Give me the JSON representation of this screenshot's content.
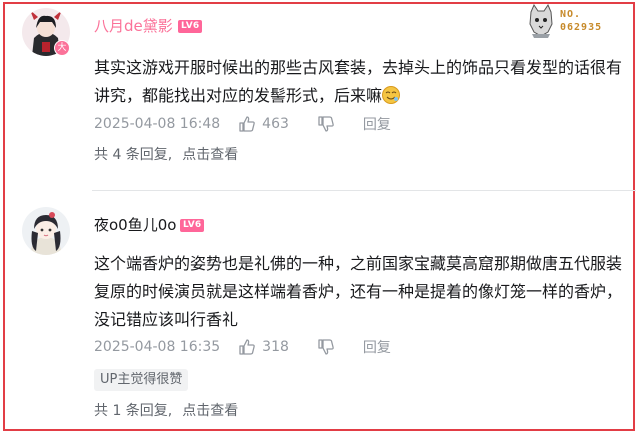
{
  "watermark": {
    "line1": "NO.",
    "line2": "062935"
  },
  "comments": [
    {
      "username": "八月de黛影",
      "level": "LV6",
      "avatar_badge": "大",
      "content": "其实这游戏开服时候出的那些古风套装，去掉头上的饰品只看发型的话很有讲究，都能找出对应的发髻形式，后来嘛",
      "emoji": "doge-emoji",
      "time": "2025-04-08 16:48",
      "likes": "463",
      "reply_label": "回复",
      "sub_count_text": "共 4 条回复,",
      "sub_link_text": "点击查看"
    },
    {
      "username": "夜o0鱼儿0o",
      "level": "LV6",
      "content": "这个端香炉的姿势也是礼佛的一种，之前国家宝藏莫高窟那期做唐五代服装复原的时候演员就是这样端着香炉，还有一种是提着的像灯笼一样的香炉，没记错应该叫行香礼",
      "time": "2025-04-08 16:35",
      "likes": "318",
      "reply_label": "回复",
      "up_tag": "UP主觉得很赞",
      "sub_count_text": "共 1 条回复,",
      "sub_link_text": "点击查看"
    }
  ],
  "colors": {
    "frame": "#e23d45",
    "vip_name": "#fb7299",
    "meta": "#9499a0",
    "level_badge": "#ff6699"
  }
}
